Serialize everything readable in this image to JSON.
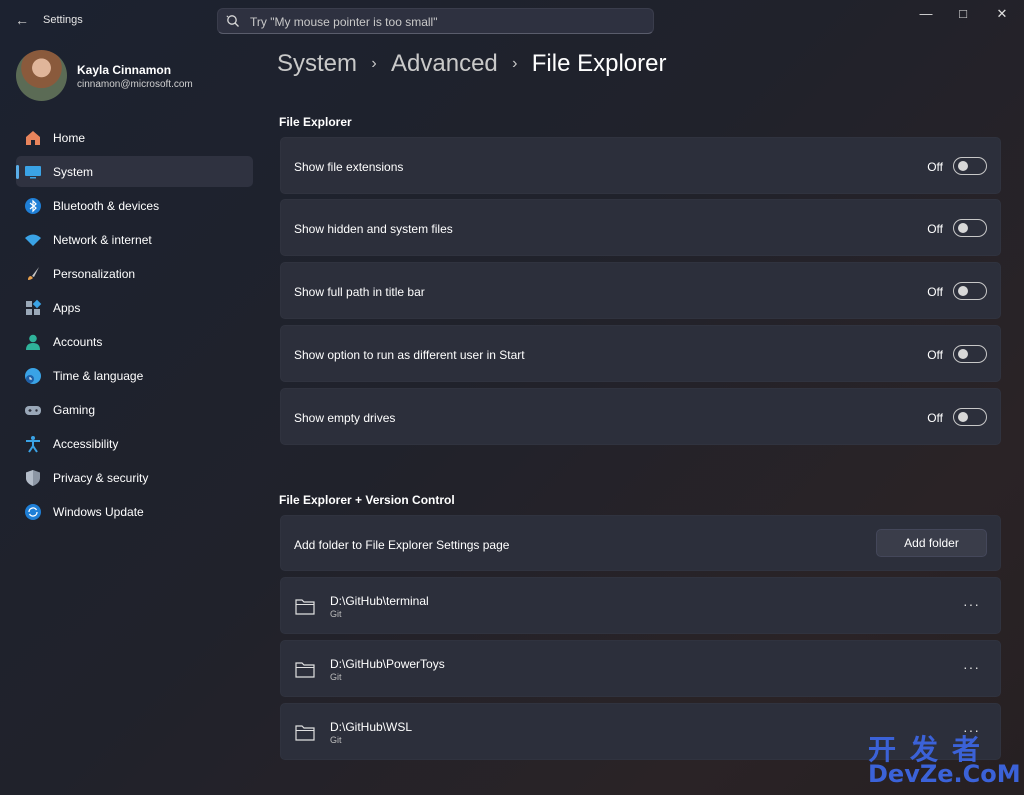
{
  "window": {
    "title": "Settings",
    "back_icon": "back-arrow-icon",
    "controls": [
      "minimize",
      "maximize",
      "close"
    ]
  },
  "search": {
    "placeholder": "Try \"My mouse pointer is too small\""
  },
  "profile": {
    "name": "Kayla Cinnamon",
    "email": "cinnamon@microsoft.com"
  },
  "sidebar": {
    "items": [
      {
        "label": "Home",
        "icon": "home-icon",
        "selected": false
      },
      {
        "label": "System",
        "icon": "monitor-icon",
        "selected": true
      },
      {
        "label": "Bluetooth & devices",
        "icon": "bluetooth-icon",
        "selected": false
      },
      {
        "label": "Network & internet",
        "icon": "wifi-icon",
        "selected": false
      },
      {
        "label": "Personalization",
        "icon": "brush-icon",
        "selected": false
      },
      {
        "label": "Apps",
        "icon": "apps-icon",
        "selected": false
      },
      {
        "label": "Accounts",
        "icon": "person-icon",
        "selected": false
      },
      {
        "label": "Time & language",
        "icon": "globe-clock-icon",
        "selected": false
      },
      {
        "label": "Gaming",
        "icon": "gamepad-icon",
        "selected": false
      },
      {
        "label": "Accessibility",
        "icon": "accessibility-icon",
        "selected": false
      },
      {
        "label": "Privacy & security",
        "icon": "shield-icon",
        "selected": false
      },
      {
        "label": "Windows Update",
        "icon": "update-icon",
        "selected": false
      }
    ]
  },
  "breadcrumb": {
    "items": [
      "System",
      "Advanced",
      "File Explorer"
    ]
  },
  "file_explorer": {
    "title": "File Explorer",
    "settings": [
      {
        "label": "Show file extensions",
        "state": "Off"
      },
      {
        "label": "Show hidden and system files",
        "state": "Off"
      },
      {
        "label": "Show full path in title bar",
        "state": "Off"
      },
      {
        "label": "Show option to run as different user in Start",
        "state": "Off"
      },
      {
        "label": "Show empty drives",
        "state": "Off"
      }
    ]
  },
  "version_control": {
    "title": "File Explorer + Version Control",
    "add_label": "Add folder to File Explorer Settings page",
    "add_button": "Add folder",
    "folders": [
      {
        "path": "D:\\GitHub\\terminal",
        "type": "Git"
      },
      {
        "path": "D:\\GitHub\\PowerToys",
        "type": "Git"
      },
      {
        "path": "D:\\GitHub\\WSL",
        "type": "Git"
      }
    ]
  },
  "watermark": {
    "cn": "开发者",
    "en": "DevZe.CoM"
  },
  "colors": {
    "accent": "#5aaee8",
    "card": "#2c2f3b",
    "watermark": "#3b62d8"
  }
}
